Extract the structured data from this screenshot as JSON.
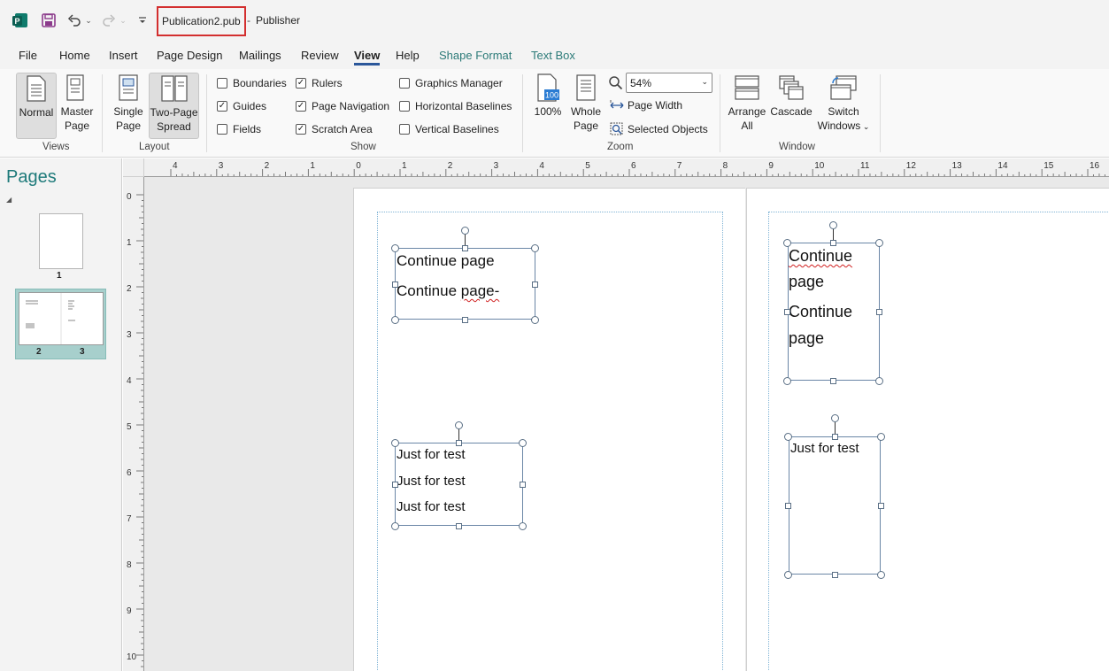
{
  "titlebar": {
    "doc_name": "Publication2.pub",
    "separator": "-",
    "app_name": "Publisher"
  },
  "tabs": [
    {
      "label": "File"
    },
    {
      "label": "Home"
    },
    {
      "label": "Insert"
    },
    {
      "label": "Page Design"
    },
    {
      "label": "Mailings"
    },
    {
      "label": "Review"
    },
    {
      "label": "View",
      "active": true
    },
    {
      "label": "Help"
    },
    {
      "label": "Shape Format",
      "contextual": true
    },
    {
      "label": "Text Box",
      "contextual": true
    }
  ],
  "ribbon": {
    "views": {
      "group_label": "Views",
      "normal": "Normal",
      "master_line1": "Master",
      "master_line2": "Page"
    },
    "layout": {
      "group_label": "Layout",
      "single_line1": "Single",
      "single_line2": "Page",
      "two_line1": "Two-Page",
      "two_line2": "Spread"
    },
    "show": {
      "group_label": "Show",
      "boundaries": {
        "label": "Boundaries",
        "checked": false
      },
      "guides": {
        "label": "Guides",
        "checked": true
      },
      "fields": {
        "label": "Fields",
        "checked": false
      },
      "rulers": {
        "label": "Rulers",
        "checked": true
      },
      "page_navigation": {
        "label": "Page Navigation",
        "checked": true
      },
      "scratch_area": {
        "label": "Scratch Area",
        "checked": true
      },
      "graphics_manager": {
        "label": "Graphics Manager",
        "checked": false
      },
      "horizontal_baselines": {
        "label": "Horizontal Baselines",
        "checked": false
      },
      "vertical_baselines": {
        "label": "Vertical Baselines",
        "checked": false
      }
    },
    "zoom": {
      "group_label": "Zoom",
      "hundred_label": "100%",
      "hundred_icon_text": "100",
      "whole_line1": "Whole",
      "whole_line2": "Page",
      "zoom_value": "54%",
      "page_width": "Page Width",
      "selected_objects": "Selected Objects"
    },
    "window": {
      "group_label": "Window",
      "arrange_line1": "Arrange",
      "arrange_line2": "All",
      "cascade": "Cascade",
      "switch_line1": "Switch",
      "switch_line2": "Windows"
    }
  },
  "pages_pane": {
    "title": "Pages",
    "page1_num": "1",
    "page2_num": "2",
    "page3_num": "3"
  },
  "rulers": {
    "horizontal_labels": [
      "4",
      "3",
      "2",
      "1",
      "0",
      "1",
      "2",
      "3",
      "4",
      "5",
      "6",
      "7",
      "8",
      "9",
      "10",
      "11",
      "12",
      "13",
      "14",
      "15",
      "16"
    ],
    "vertical_labels": [
      "0",
      "1",
      "2",
      "3",
      "4",
      "5",
      "6",
      "7",
      "8",
      "9",
      "10"
    ]
  },
  "canvas": {
    "box1": {
      "line1": "Continue page",
      "line2a": "Continue ",
      "line2b": "page-"
    },
    "box2": {
      "line1": "Just for test",
      "line2": "Just for test",
      "line3": "Just for test"
    },
    "box3": {
      "line1": "Continue",
      "line2": "page",
      "line3": "Continue",
      "line4": "page"
    },
    "box4": {
      "line1": "Just for test"
    }
  },
  "colors": {
    "accent": "#2b579a",
    "contextual_tab": "#2b7a78",
    "title_highlight": "#d32f2f",
    "pages_title": "#1e7a7a"
  }
}
